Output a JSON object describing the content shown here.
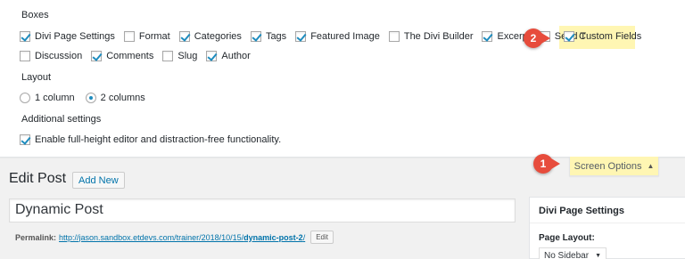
{
  "screen_options": {
    "boxes_title": "Boxes",
    "boxes_row1": [
      {
        "label": "Divi Page Settings",
        "checked": true
      },
      {
        "label": "Format",
        "checked": false
      },
      {
        "label": "Categories",
        "checked": true
      },
      {
        "label": "Tags",
        "checked": true
      },
      {
        "label": "Featured Image",
        "checked": true
      },
      {
        "label": "The Divi Builder",
        "checked": false
      },
      {
        "label": "Excerpt",
        "checked": true
      },
      {
        "label": "Send T",
        "checked": false
      },
      {
        "label": "Custom Fields",
        "checked": true
      }
    ],
    "boxes_row2": [
      {
        "label": "Discussion",
        "checked": false
      },
      {
        "label": "Comments",
        "checked": true
      },
      {
        "label": "Slug",
        "checked": false
      },
      {
        "label": "Author",
        "checked": true
      }
    ],
    "layout_title": "Layout",
    "layout_options": [
      {
        "label": "1 column",
        "selected": false
      },
      {
        "label": "2 columns",
        "selected": true
      }
    ],
    "additional_title": "Additional settings",
    "additional_option": {
      "label": "Enable full-height editor and distraction-free functionality.",
      "checked": true
    },
    "tab_label": "Screen Options",
    "tab_arrow": "▲"
  },
  "callouts": {
    "one": "1",
    "two": "2",
    "color": "#e74c3c",
    "highlight_color": "#fff6b3"
  },
  "editor": {
    "page_title": "Edit Post",
    "add_new_label": "Add New",
    "post_title": "Dynamic Post",
    "permalink_label": "Permalink:",
    "permalink_base": "http://jason.sandbox.etdevs.com/trainer/2018/10/15/",
    "permalink_slug": "dynamic-post-2",
    "permalink_trail": "/",
    "edit_label": "Edit"
  },
  "sidebar_box": {
    "title": "Divi Page Settings",
    "field_label": "Page Layout:",
    "select_value": "No Sidebar",
    "select_arrow": "▼"
  }
}
